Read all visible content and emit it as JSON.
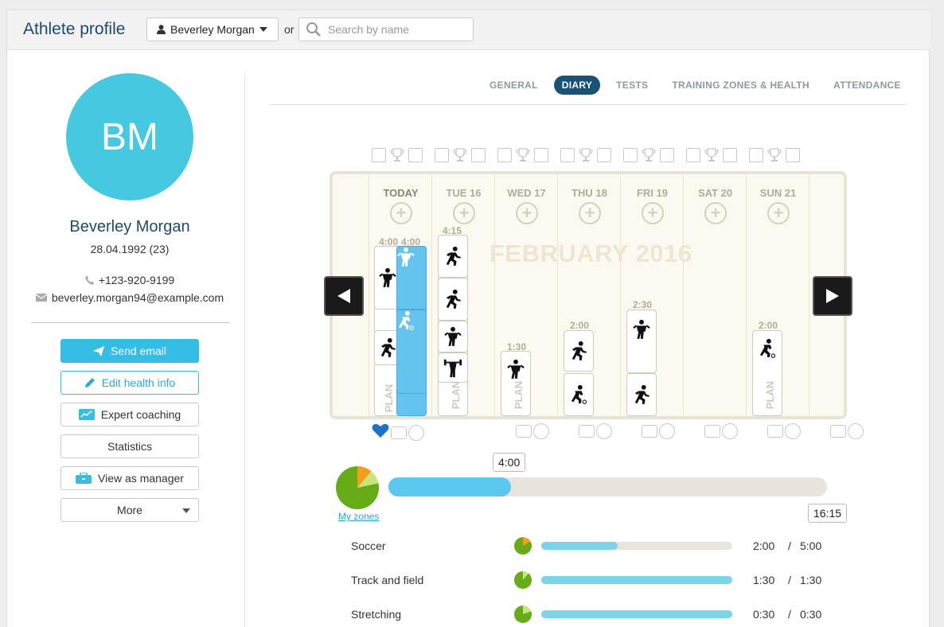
{
  "header": {
    "title": "Athlete profile",
    "athlete_select": "Beverley Morgan",
    "or_label": "or",
    "search_placeholder": "Search by name"
  },
  "profile": {
    "initials": "BM",
    "name": "Beverley Morgan",
    "dob": "28.04.1992 (23)",
    "phone": "+123-920-9199",
    "email": "beverley.morgan94@example.com",
    "avatar_color": "#45c9e0"
  },
  "actions": {
    "send_email": "Send email",
    "edit_health": "Edit health info",
    "expert_coaching": "Expert coaching",
    "statistics": "Statistics",
    "view_manager": "View as manager",
    "more": "More"
  },
  "tabs": [
    {
      "label": "GENERAL",
      "active": false
    },
    {
      "label": "DIARY",
      "active": true
    },
    {
      "label": "TESTS",
      "active": false
    },
    {
      "label": "TRAINING ZONES & HEALTH",
      "active": false
    },
    {
      "label": "ATTENDANCE",
      "active": false
    }
  ],
  "calendar": {
    "month": "FEBRUARY 2016",
    "days": [
      "TODAY",
      "TUE 16",
      "WED 17",
      "THU 18",
      "FRI 19",
      "SAT 20",
      "SUN 21"
    ],
    "durations": {
      "today_plan": "4:00",
      "today_done": "4:00",
      "tue": "4:15",
      "wed": "1:30",
      "thu": "2:00",
      "fri": "2:30",
      "sun": "2:00"
    },
    "plan_label": "PLAN"
  },
  "summary": {
    "done_time": "4:00",
    "plan_time": "16:15",
    "done_fraction": 0.28,
    "zones_link": "My zones"
  },
  "sports": [
    {
      "name": "Soccer",
      "done": "2:00",
      "sep": "/",
      "total": "5:00",
      "fraction": 0.4
    },
    {
      "name": "Track and field",
      "done": "1:30",
      "sep": "/",
      "total": "1:30",
      "fraction": 1.0
    },
    {
      "name": "Stretching",
      "done": "0:30",
      "sep": "/",
      "total": "0:30",
      "fraction": 1.0
    }
  ],
  "icons": [
    "user-icon",
    "search-icon",
    "phone-icon",
    "envelope-icon",
    "paper-plane-icon",
    "pencil-icon",
    "chart-icon",
    "briefcase-icon",
    "heart-icon",
    "calendar-icon",
    "trophy-icon",
    "comment-icon",
    "play-left-icon",
    "play-right-icon",
    "plus-icon"
  ],
  "colors": {
    "accent": "#35bde6",
    "navy": "#1a5276",
    "done_block": "#65c4ee",
    "pie_green": "#66ac19",
    "pie_orange": "#f59c1a"
  }
}
